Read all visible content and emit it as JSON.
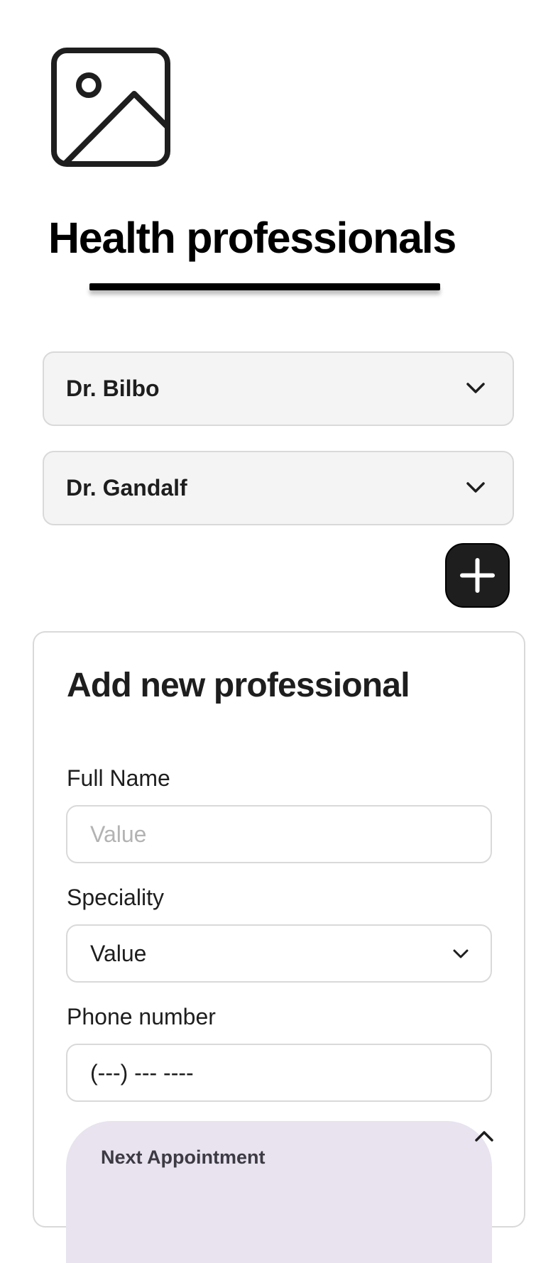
{
  "page": {
    "title": "Health professionals",
    "image_icon": "image-placeholder-icon"
  },
  "professionals": [
    {
      "name": "Dr. Bilbo",
      "icon": "chevron-down-icon"
    },
    {
      "name": "Dr. Gandalf",
      "icon": "chevron-down-icon"
    }
  ],
  "add_button": {
    "icon": "plus-icon"
  },
  "form": {
    "heading": "Add new professional",
    "full_name": {
      "label": "Full Name",
      "placeholder": "Value",
      "value": ""
    },
    "speciality": {
      "label": "Speciality",
      "value": "Value",
      "icon": "chevron-down-icon"
    },
    "phone": {
      "label": "Phone number",
      "placeholder": "(---) --- ----",
      "value": ""
    },
    "next_appointment": {
      "title": "Next Appointment",
      "icon": "chevron-up-icon"
    }
  },
  "colors": {
    "text": "#1e1e1e",
    "item_bg": "#f4f4f4",
    "border": "#d9d9d9",
    "button_bg": "#1e1e1e",
    "appointment_bg": "#e8e3ef",
    "placeholder": "#b3b3b3"
  }
}
